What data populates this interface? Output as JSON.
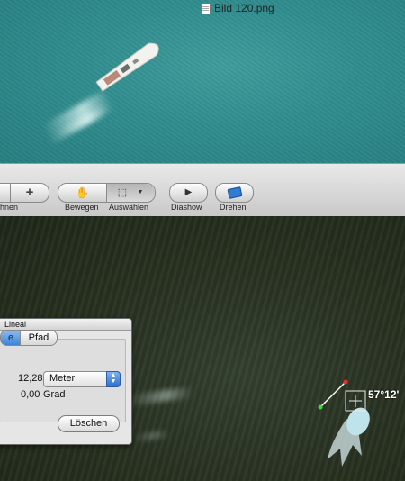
{
  "window": {
    "title": "Bild 120.png"
  },
  "toolbar": {
    "partial_label": "hnen",
    "move_label": "Bewegen",
    "select_label": "Auswählen",
    "slideshow_label": "Diashow",
    "rotate_label": "Drehen"
  },
  "ruler_panel": {
    "title": "Lineal",
    "tabs": [
      {
        "label": "e",
        "active": true
      },
      {
        "label": "Pfad",
        "active": false
      }
    ],
    "length_value": "12,28",
    "unit_options_selected": "Meter",
    "angle_value": "0,00",
    "angle_unit": "Grad",
    "delete_label": "Löschen"
  },
  "overlay": {
    "angle_readout": "57°12'"
  },
  "colors": {
    "water": "#2f8c8d",
    "dark_water": "#27301f",
    "measure_start": "#2ee62e",
    "measure_end": "#e62e2e",
    "tab_active": "#3f83d8"
  }
}
